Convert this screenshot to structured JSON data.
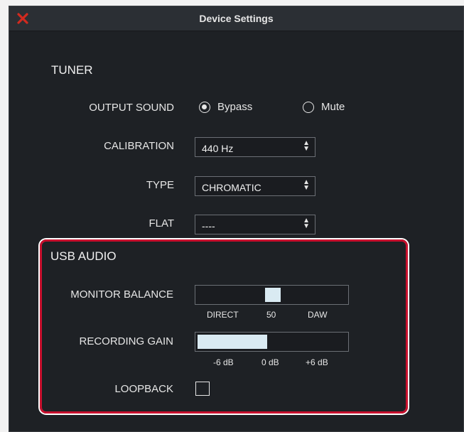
{
  "window": {
    "title": "Device Settings"
  },
  "tuner": {
    "section_title": "TUNER",
    "output_sound": {
      "label": "OUTPUT SOUND",
      "options": [
        "Bypass",
        "Mute"
      ],
      "selected": "Bypass"
    },
    "calibration": {
      "label": "CALIBRATION",
      "value": "440 Hz"
    },
    "type": {
      "label": "TYPE",
      "value": "CHROMATIC"
    },
    "flat": {
      "label": "FLAT",
      "value": "----"
    }
  },
  "usb_audio": {
    "section_title": "USB AUDIO",
    "monitor_balance": {
      "label": "MONITOR BALANCE",
      "ticks": [
        "DIRECT",
        "50",
        "DAW"
      ],
      "value": 50
    },
    "recording_gain": {
      "label": "RECORDING GAIN",
      "ticks": [
        "-6 dB",
        "0 dB",
        "+6 dB"
      ],
      "value_db": 0
    },
    "loopback": {
      "label": "LOOPBACK",
      "checked": false
    }
  },
  "colors": {
    "background": "#1e2125",
    "highlight_border": "#c8102e",
    "slider_fill": "#d9eaf2",
    "close_icon": "#d12a1f"
  },
  "icons": {
    "close": "close-icon",
    "select_arrows": "up-down-arrows-icon"
  }
}
